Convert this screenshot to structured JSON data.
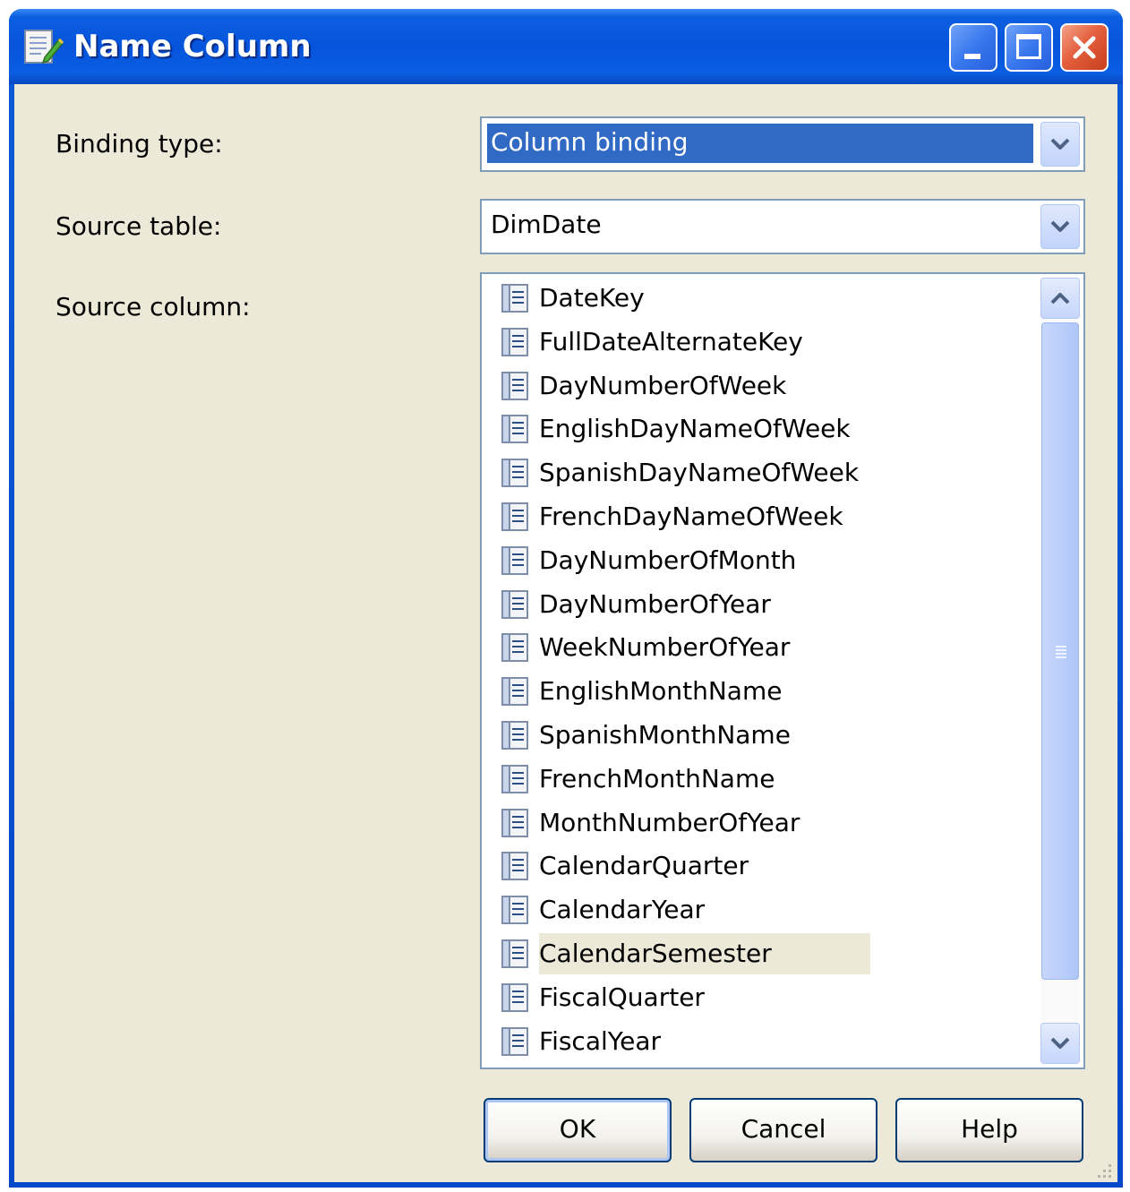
{
  "window": {
    "title": "Name Column",
    "icon": "dialog-edit-icon",
    "controls": [
      "minimize-icon",
      "maximize-icon",
      "close-icon"
    ]
  },
  "form": {
    "binding_type_label": "Binding type:",
    "binding_type_value": "Column binding",
    "source_table_label": "Source table:",
    "source_table_value": "DimDate",
    "source_column_label": "Source column:"
  },
  "columns": [
    "DateKey",
    "FullDateAlternateKey",
    "DayNumberOfWeek",
    "EnglishDayNameOfWeek",
    "SpanishDayNameOfWeek",
    "FrenchDayNameOfWeek",
    "DayNumberOfMonth",
    "DayNumberOfYear",
    "WeekNumberOfYear",
    "EnglishMonthName",
    "SpanishMonthName",
    "FrenchMonthName",
    "MonthNumberOfYear",
    "CalendarQuarter",
    "CalendarYear",
    "CalendarSemester",
    "FiscalQuarter",
    "FiscalYear"
  ],
  "highlighted_column": "CalendarSemester",
  "buttons": {
    "ok": "OK",
    "cancel": "Cancel",
    "help": "Help"
  },
  "colors": {
    "titlebar": "#0554dc",
    "dialog_bg": "#ece9d8",
    "selection": "#316ac5",
    "close_button": "#e4603f"
  }
}
